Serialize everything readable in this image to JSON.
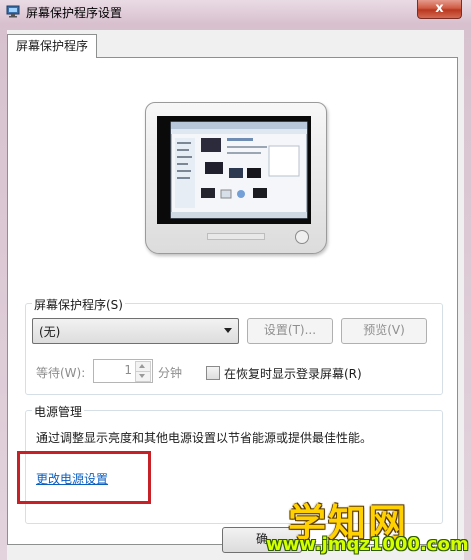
{
  "window": {
    "title": "屏幕保护程序设置",
    "close_label": "x"
  },
  "tabs": [
    {
      "label": "屏幕保护程序"
    }
  ],
  "screensaver": {
    "group_label": "屏幕保护程序(S)",
    "selected": "(无)",
    "settings_button": "设置(T)...",
    "preview_button": "预览(V)",
    "wait_label": "等待(W):",
    "wait_value": "1",
    "wait_unit": "分钟",
    "resume_checkbox_label": "在恢复时显示登录屏幕(R)",
    "resume_checked": false
  },
  "power": {
    "group_label": "电源管理",
    "description": "通过调整显示亮度和其他电源设置以节省能源或提供最佳性能。",
    "link_label": "更改电源设置"
  },
  "footer": {
    "ok_button": "确"
  },
  "watermark": {
    "text": "学知网",
    "url": "www.jmqz1000.com"
  },
  "icons": {
    "app": "screensaver-settings-icon",
    "spin_up": "arrow-up-icon",
    "spin_down": "arrow-down-icon",
    "combo": "chevron-down-icon"
  },
  "colors": {
    "link": "#0b5fc1",
    "highlight_box": "#c52127",
    "watermark_text": "#ffd100",
    "close_button": "#c94b35"
  }
}
